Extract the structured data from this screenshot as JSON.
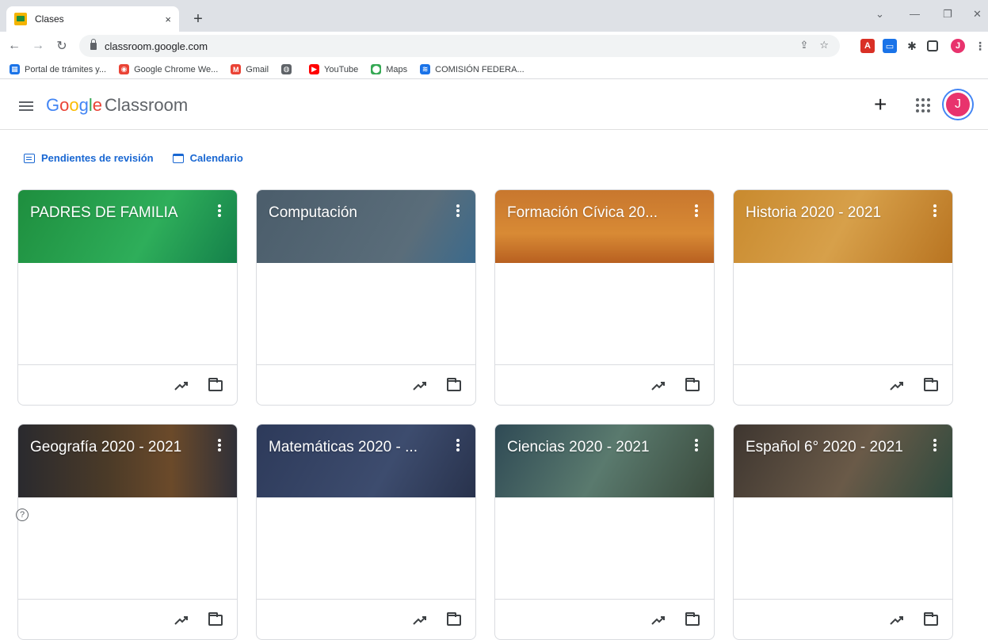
{
  "browser": {
    "tab_title": "Clases",
    "tab_close": "×",
    "new_tab": "+",
    "url": "classroom.google.com",
    "bookmarks": [
      {
        "label": "Portal de trámites y...",
        "icon": "grid-icon",
        "color": "#1a73e8"
      },
      {
        "label": "Google Chrome We...",
        "icon": "chrome-icon",
        "color": "#ea4335"
      },
      {
        "label": "Gmail",
        "icon": "gmail-icon",
        "color": "#ea4335"
      },
      {
        "label": "",
        "icon": "globe-icon",
        "color": "#3c4043"
      },
      {
        "label": "YouTube",
        "icon": "youtube-icon",
        "color": "#ff0000"
      },
      {
        "label": "Maps",
        "icon": "maps-pin-icon",
        "color": "#34a853"
      },
      {
        "label": "COMISIÓN FEDERA...",
        "icon": "feed-icon",
        "color": "#1a73e8"
      }
    ]
  },
  "app": {
    "brand_google": "Google",
    "brand_product": "Classroom",
    "avatar_initial": "J",
    "avatar_color": "#e8336d"
  },
  "quick_links": {
    "todo": "Pendientes de revisión",
    "calendar": "Calendario"
  },
  "classes": [
    {
      "title": "PADRES DE FAMILIA",
      "banner": "green"
    },
    {
      "title": "Computación",
      "banner": "slate"
    },
    {
      "title": "Formación Cívica 20...",
      "banner": "orange"
    },
    {
      "title": "Historia 2020 - 2021",
      "banner": "amber"
    },
    {
      "title": "Geografía 2020 - 2021",
      "banner": "space"
    },
    {
      "title": "Matemáticas 2020 - ...",
      "banner": "navy"
    },
    {
      "title": "Ciencias 2020 - 2021",
      "banner": "teal"
    },
    {
      "title": "Español 6° 2020 - 2021",
      "banner": "brown"
    }
  ],
  "help_icon": "?"
}
